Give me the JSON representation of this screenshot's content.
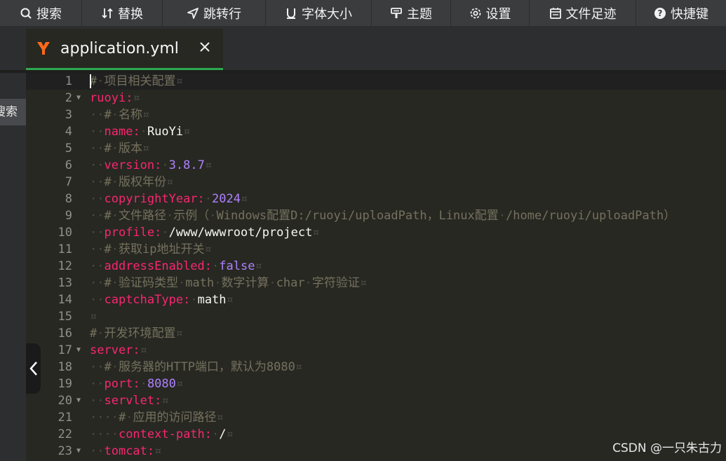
{
  "toolbar": {
    "items": [
      {
        "label": "搜索",
        "icon": "search-icon"
      },
      {
        "label": "替换",
        "icon": "replace-icon"
      },
      {
        "label": "跳转行",
        "icon": "goto-line-icon"
      },
      {
        "label": "字体大小",
        "icon": "font-size-icon"
      },
      {
        "label": "主题",
        "icon": "theme-icon"
      },
      {
        "label": "设置",
        "icon": "gear-icon"
      },
      {
        "label": "文件足迹",
        "icon": "calendar-icon"
      },
      {
        "label": "快捷键",
        "icon": "help-icon"
      }
    ]
  },
  "sidebar": {
    "search_label": "搜索"
  },
  "tab": {
    "title": "application.yml",
    "icon": "yaml-file-icon"
  },
  "colors": {
    "background": "#272822",
    "comment": "#75715e",
    "key": "#f92672",
    "number": "#ae81ff",
    "text": "#f8f8f2",
    "active_tab_underline": "#2fa84f"
  },
  "editor": {
    "lines": [
      {
        "n": "1",
        "fold": false,
        "tokens": [
          [
            "cm",
            "#"
          ],
          [
            "ws",
            "·"
          ],
          [
            "cm",
            "项目相关配置"
          ],
          [
            "ws",
            "¤"
          ]
        ]
      },
      {
        "n": "2",
        "fold": true,
        "tokens": [
          [
            "key",
            "ruoyi"
          ],
          [
            "pun",
            ":"
          ],
          [
            "ws",
            "¤"
          ]
        ]
      },
      {
        "n": "3",
        "fold": false,
        "tokens": [
          [
            "ws",
            "··"
          ],
          [
            "cm",
            "#"
          ],
          [
            "ws",
            "·"
          ],
          [
            "cm",
            "名称"
          ],
          [
            "ws",
            "¤"
          ]
        ]
      },
      {
        "n": "4",
        "fold": false,
        "tokens": [
          [
            "ws",
            "··"
          ],
          [
            "key",
            "name"
          ],
          [
            "pun",
            ":"
          ],
          [
            "ws",
            "·"
          ],
          [
            "str",
            "RuoYi"
          ],
          [
            "ws",
            "¤"
          ]
        ]
      },
      {
        "n": "5",
        "fold": false,
        "tokens": [
          [
            "ws",
            "··"
          ],
          [
            "cm",
            "#"
          ],
          [
            "ws",
            "·"
          ],
          [
            "cm",
            "版本"
          ],
          [
            "ws",
            "¤"
          ]
        ]
      },
      {
        "n": "6",
        "fold": false,
        "tokens": [
          [
            "ws",
            "··"
          ],
          [
            "key",
            "version"
          ],
          [
            "pun",
            ":"
          ],
          [
            "ws",
            "·"
          ],
          [
            "num",
            "3.8.7"
          ],
          [
            "ws",
            "¤"
          ]
        ]
      },
      {
        "n": "7",
        "fold": false,
        "tokens": [
          [
            "ws",
            "··"
          ],
          [
            "cm",
            "#"
          ],
          [
            "ws",
            "·"
          ],
          [
            "cm",
            "版权年份"
          ],
          [
            "ws",
            "¤"
          ]
        ]
      },
      {
        "n": "8",
        "fold": false,
        "tokens": [
          [
            "ws",
            "··"
          ],
          [
            "key",
            "copyrightYear"
          ],
          [
            "pun",
            ":"
          ],
          [
            "ws",
            "·"
          ],
          [
            "num",
            "2024"
          ],
          [
            "ws",
            "¤"
          ]
        ]
      },
      {
        "n": "9",
        "fold": false,
        "tokens": [
          [
            "ws",
            "··"
          ],
          [
            "cm",
            "#"
          ],
          [
            "ws",
            "·"
          ],
          [
            "cm",
            "文件路径"
          ],
          [
            "ws",
            "·"
          ],
          [
            "cm",
            "示例（"
          ],
          [
            "ws",
            "·"
          ],
          [
            "cm",
            "Windows配置D:/ruoyi/uploadPath，Linux配置"
          ],
          [
            "ws",
            "·"
          ],
          [
            "cm",
            "/home/ruoyi/uploadPath）"
          ]
        ]
      },
      {
        "n": "10",
        "fold": false,
        "tokens": [
          [
            "ws",
            "··"
          ],
          [
            "key",
            "profile"
          ],
          [
            "pun",
            ":"
          ],
          [
            "ws",
            "·"
          ],
          [
            "str",
            "/www/wwwroot/project"
          ],
          [
            "ws",
            "¤"
          ]
        ]
      },
      {
        "n": "11",
        "fold": false,
        "tokens": [
          [
            "ws",
            "··"
          ],
          [
            "cm",
            "#"
          ],
          [
            "ws",
            "·"
          ],
          [
            "cm",
            "获取ip地址开关"
          ],
          [
            "ws",
            "¤"
          ]
        ]
      },
      {
        "n": "12",
        "fold": false,
        "tokens": [
          [
            "ws",
            "··"
          ],
          [
            "key",
            "addressEnabled"
          ],
          [
            "pun",
            ":"
          ],
          [
            "ws",
            "·"
          ],
          [
            "num",
            "false"
          ],
          [
            "ws",
            "¤"
          ]
        ]
      },
      {
        "n": "13",
        "fold": false,
        "tokens": [
          [
            "ws",
            "··"
          ],
          [
            "cm",
            "#"
          ],
          [
            "ws",
            "·"
          ],
          [
            "cm",
            "验证码类型"
          ],
          [
            "ws",
            "·"
          ],
          [
            "cm",
            "math"
          ],
          [
            "ws",
            "·"
          ],
          [
            "cm",
            "数字计算"
          ],
          [
            "ws",
            "·"
          ],
          [
            "cm",
            "char"
          ],
          [
            "ws",
            "·"
          ],
          [
            "cm",
            "字符验证"
          ],
          [
            "ws",
            "¤"
          ]
        ]
      },
      {
        "n": "14",
        "fold": false,
        "tokens": [
          [
            "ws",
            "··"
          ],
          [
            "key",
            "captchaType"
          ],
          [
            "pun",
            ":"
          ],
          [
            "ws",
            "·"
          ],
          [
            "str",
            "math"
          ],
          [
            "ws",
            "¤"
          ]
        ]
      },
      {
        "n": "15",
        "fold": false,
        "tokens": [
          [
            "ws",
            "¤"
          ]
        ]
      },
      {
        "n": "16",
        "fold": false,
        "tokens": [
          [
            "cm",
            "#"
          ],
          [
            "ws",
            "·"
          ],
          [
            "cm",
            "开发环境配置"
          ],
          [
            "ws",
            "¤"
          ]
        ]
      },
      {
        "n": "17",
        "fold": true,
        "tokens": [
          [
            "key",
            "server"
          ],
          [
            "pun",
            ":"
          ],
          [
            "ws",
            "¤"
          ]
        ]
      },
      {
        "n": "18",
        "fold": false,
        "tokens": [
          [
            "ws",
            "··"
          ],
          [
            "cm",
            "#"
          ],
          [
            "ws",
            "·"
          ],
          [
            "cm",
            "服务器的HTTP端口，默认为8080"
          ],
          [
            "ws",
            "¤"
          ]
        ]
      },
      {
        "n": "19",
        "fold": false,
        "tokens": [
          [
            "ws",
            "··"
          ],
          [
            "key",
            "port"
          ],
          [
            "pun",
            ":"
          ],
          [
            "ws",
            "·"
          ],
          [
            "num",
            "8080"
          ],
          [
            "ws",
            "¤"
          ]
        ]
      },
      {
        "n": "20",
        "fold": true,
        "tokens": [
          [
            "ws",
            "··"
          ],
          [
            "key",
            "servlet"
          ],
          [
            "pun",
            ":"
          ],
          [
            "ws",
            "¤"
          ]
        ]
      },
      {
        "n": "21",
        "fold": false,
        "tokens": [
          [
            "ws",
            "····"
          ],
          [
            "cm",
            "#"
          ],
          [
            "ws",
            "·"
          ],
          [
            "cm",
            "应用的访问路径"
          ],
          [
            "ws",
            "¤"
          ]
        ]
      },
      {
        "n": "22",
        "fold": false,
        "tokens": [
          [
            "ws",
            "····"
          ],
          [
            "key",
            "context-path"
          ],
          [
            "pun",
            ":"
          ],
          [
            "ws",
            "·"
          ],
          [
            "str",
            "/"
          ],
          [
            "ws",
            "¤"
          ]
        ]
      },
      {
        "n": "23",
        "fold": true,
        "tokens": [
          [
            "ws",
            "··"
          ],
          [
            "key",
            "tomcat"
          ],
          [
            "pun",
            ":"
          ],
          [
            "ws",
            "¤"
          ]
        ]
      }
    ]
  },
  "watermark": "CSDN @一只朱古力"
}
